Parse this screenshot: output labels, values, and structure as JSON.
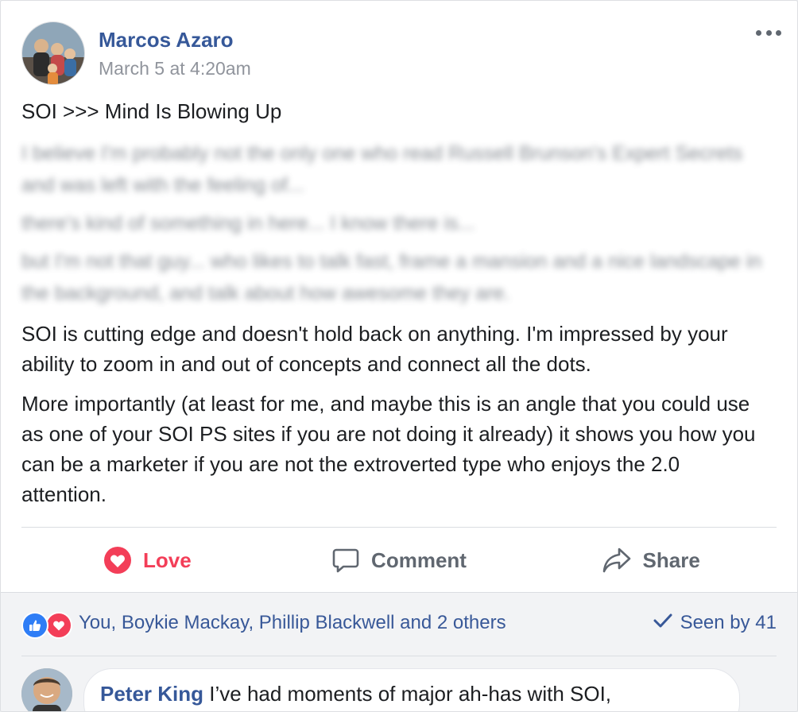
{
  "post": {
    "author": "Marcos Azaro",
    "timestamp": "March 5 at 4:20am",
    "title": "SOI >>> Mind Is Blowing Up",
    "blurred_paragraphs": [
      "I believe I'm probably not the only one who read Russell Brunson's Expert Secrets and was left with the feeling of...",
      "there's kind of something in here... I know there is...",
      "but I'm not that guy... who likes to talk fast, frame a mansion and a nice landscape in the background, and talk about how awesome they are."
    ],
    "paragraphs": [
      "SOI is cutting edge and doesn't hold back on anything. I'm impressed by your ability to zoom in and out of concepts and connect all the dots.",
      "More importantly (at least for me, and maybe this is an angle that you could use as one of your SOI PS sites if you are not doing it already) it shows you how you can be a marketer if you are not the extroverted type who enjoys the 2.0 attention."
    ]
  },
  "actions": {
    "love_label": "Love",
    "comment_label": "Comment",
    "share_label": "Share"
  },
  "reactions": {
    "icons": [
      "like-icon",
      "love-icon"
    ],
    "names": "You, Boykie Mackay, Phillip Blackwell and 2 others",
    "seen": "Seen by 41"
  },
  "comment": {
    "author": "Peter King",
    "text": "I’ve had moments of major ah-has with SOI,"
  },
  "colors": {
    "link": "#365899",
    "love": "#f33e58",
    "like": "#2e7df6",
    "muted": "#606770"
  }
}
